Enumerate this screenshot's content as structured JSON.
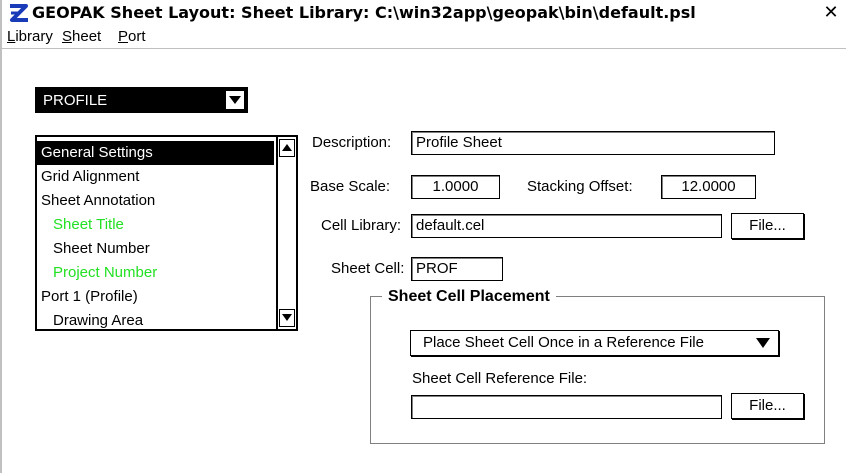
{
  "window": {
    "title": "GEOPAK Sheet Layout: Sheet Library: C:\\win32app\\geopak\\bin\\default.psl",
    "close_label": "✕"
  },
  "menu": {
    "items": [
      {
        "underline": "L",
        "rest": "ibrary"
      },
      {
        "underline": "S",
        "rest": "heet"
      },
      {
        "underline": "P",
        "rest": "ort"
      }
    ]
  },
  "sheet_type": {
    "selected": "PROFILE"
  },
  "settings_list": {
    "items": [
      {
        "label": "General Settings",
        "selected": true,
        "indent": false,
        "color": "#000000"
      },
      {
        "label": "Grid Alignment",
        "selected": false,
        "indent": false,
        "color": "#000000"
      },
      {
        "label": "Sheet Annotation",
        "selected": false,
        "indent": false,
        "color": "#000000"
      },
      {
        "label": "Sheet Title",
        "selected": false,
        "indent": true,
        "color": "#22e022"
      },
      {
        "label": "Sheet Number",
        "selected": false,
        "indent": true,
        "color": "#000000"
      },
      {
        "label": "Project Number",
        "selected": false,
        "indent": true,
        "color": "#22e022"
      },
      {
        "label": "Port 1 (Profile)",
        "selected": false,
        "indent": false,
        "color": "#000000"
      },
      {
        "label": "Drawing Area",
        "selected": false,
        "indent": true,
        "color": "#000000"
      }
    ]
  },
  "form": {
    "description_label": "Description:",
    "description_value": "Profile Sheet",
    "base_scale_label": "Base Scale:",
    "base_scale_value": "1.0000",
    "stacking_offset_label": "Stacking Offset:",
    "stacking_offset_value": "12.0000",
    "cell_library_label": "Cell Library:",
    "cell_library_value": "default.cel",
    "file_button_label": "File...",
    "sheet_cell_label": "Sheet Cell:",
    "sheet_cell_value": "PROF"
  },
  "placement": {
    "group_title": "Sheet Cell Placement",
    "mode_selected": "Place Sheet Cell Once in a Reference File",
    "ref_file_label": "Sheet Cell Reference File:",
    "ref_file_value": "",
    "file_button_label": "File..."
  }
}
